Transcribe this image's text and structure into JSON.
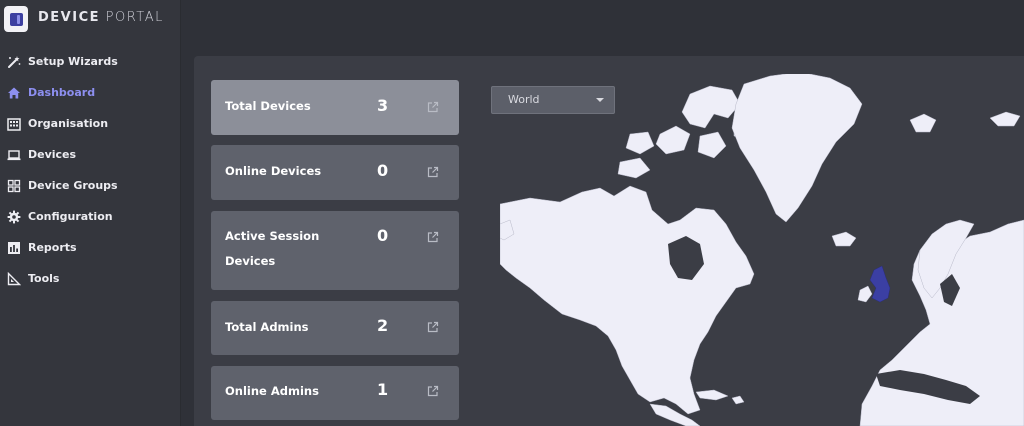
{
  "brand": {
    "bold": "DEVICE",
    "light": "PORTAL"
  },
  "sidebar": {
    "items": [
      {
        "label": "Setup Wizards",
        "icon": "wand-icon",
        "active": false
      },
      {
        "label": "Dashboard",
        "icon": "home-icon",
        "active": true
      },
      {
        "label": "Organisation",
        "icon": "building-icon",
        "active": false
      },
      {
        "label": "Devices",
        "icon": "laptop-icon",
        "active": false
      },
      {
        "label": "Device Groups",
        "icon": "grid-icon",
        "active": false
      },
      {
        "label": "Configuration",
        "icon": "gear-icon",
        "active": false
      },
      {
        "label": "Reports",
        "icon": "bar-chart-icon",
        "active": false
      },
      {
        "label": "Tools",
        "icon": "ruler-icon",
        "active": false
      }
    ],
    "active_color": "#8d8ff0"
  },
  "stats": [
    {
      "label_lines": [
        "Total Devices"
      ],
      "value": "3"
    },
    {
      "label_lines": [
        "Online Devices"
      ],
      "value": "0"
    },
    {
      "label_lines": [
        "Active Session",
        "Devices"
      ],
      "value": "0"
    },
    {
      "label_lines": [
        "Total Admins"
      ],
      "value": "2"
    },
    {
      "label_lines": [
        "Online Admins"
      ],
      "value": "1"
    }
  ],
  "region_select": {
    "value": "World"
  },
  "map": {
    "highlighted_country": "United Kingdom",
    "land_color": "#eeeef8",
    "highlight_color": "#3b3fa3"
  }
}
